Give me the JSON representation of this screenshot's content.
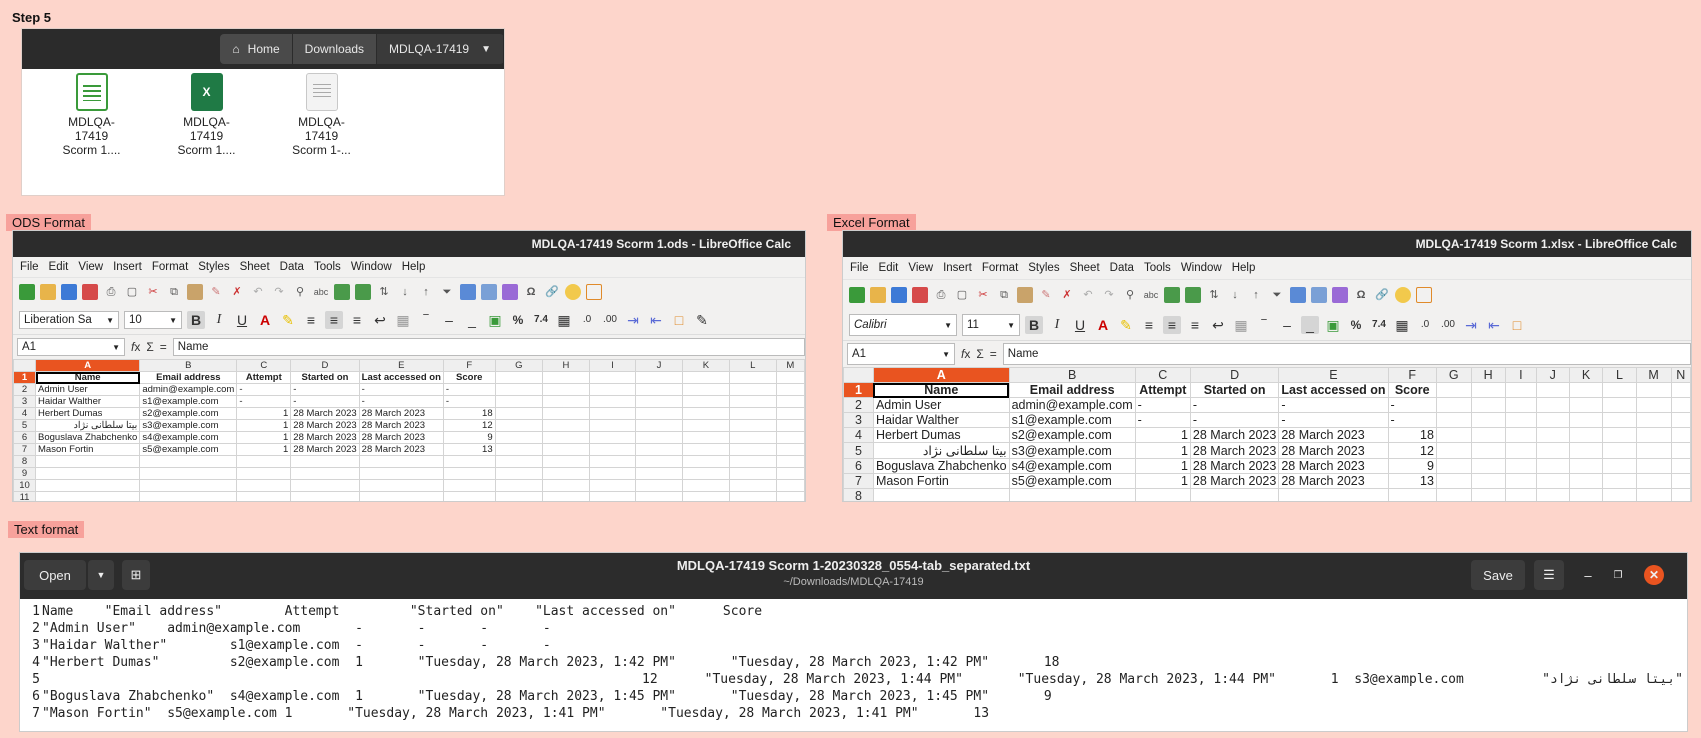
{
  "step_label": "Step 5",
  "file_manager": {
    "crumbs": [
      "Home",
      "Downloads",
      "MDLQA-17419"
    ],
    "files": [
      {
        "label": "MDLQA-17419 Scorm 1....",
        "icon": "spreadsheet-ods-icon"
      },
      {
        "label": "MDLQA-17419 Scorm 1....",
        "icon": "excel-xlsx-icon"
      },
      {
        "label": "MDLQA-17419 Scorm 1-...",
        "icon": "text-file-icon"
      }
    ],
    "xls_glyph": "X"
  },
  "ods": {
    "section_label": "ODS Format",
    "title": "MDLQA-17419 Scorm 1.ods - LibreOffice Calc",
    "menu": [
      "File",
      "Edit",
      "View",
      "Insert",
      "Format",
      "Styles",
      "Sheet",
      "Data",
      "Tools",
      "Window",
      "Help"
    ],
    "font_name": "Liberation Sa",
    "font_size": "10",
    "cell_ref": "A1",
    "formula": "Name",
    "columns": [
      "A",
      "B",
      "C",
      "D",
      "E",
      "F",
      "G",
      "H",
      "I",
      "J",
      "K",
      "L",
      "M"
    ],
    "rows": [
      [
        "Name",
        "Email address",
        "Attempt",
        "Started on",
        "Last accessed on",
        "Score"
      ],
      [
        "Admin User",
        "admin@example.com",
        "-",
        "-",
        "-",
        "-"
      ],
      [
        "Haidar Walther",
        "s1@example.com",
        "-",
        "-",
        "-",
        "-"
      ],
      [
        "Herbert Dumas",
        "s2@example.com",
        "1",
        "28 March 2023",
        "28 March 2023",
        "18"
      ],
      [
        "بیتا سلطانی نژاد",
        "s3@example.com",
        "1",
        "28 March 2023",
        "28 March 2023",
        "12"
      ],
      [
        "Boguslava Zhabchenko",
        "s4@example.com",
        "1",
        "28 March 2023",
        "28 March 2023",
        "9"
      ],
      [
        "Mason Fortin",
        "s5@example.com",
        "1",
        "28 March 2023",
        "28 March 2023",
        "13"
      ],
      [
        "",
        "",
        "",
        "",
        "",
        ""
      ],
      [
        "",
        "",
        "",
        "",
        "",
        ""
      ],
      [
        "",
        "",
        "",
        "",
        "",
        ""
      ],
      [
        "",
        "",
        "",
        "",
        "",
        ""
      ]
    ]
  },
  "xlsx": {
    "section_label": "Excel Format",
    "title": "MDLQA-17419 Scorm 1.xlsx - LibreOffice Calc",
    "menu": [
      "File",
      "Edit",
      "View",
      "Insert",
      "Format",
      "Styles",
      "Sheet",
      "Data",
      "Tools",
      "Window",
      "Help"
    ],
    "font_name": "Calibri",
    "font_size": "11",
    "cell_ref": "A1",
    "formula": "Name",
    "columns": [
      "A",
      "B",
      "C",
      "D",
      "E",
      "F",
      "G",
      "H",
      "I",
      "J",
      "K",
      "L",
      "M",
      "N"
    ],
    "rows": [
      [
        "Name",
        "Email address",
        "Attempt",
        "Started on",
        "Last accessed on",
        "Score"
      ],
      [
        "Admin User",
        "admin@example.com",
        "-",
        "-",
        "-",
        "-"
      ],
      [
        "Haidar Walther",
        "s1@example.com",
        "-",
        "-",
        "-",
        "-"
      ],
      [
        "Herbert Dumas",
        "s2@example.com",
        "1",
        "28 March 2023",
        "28 March 2023",
        "18"
      ],
      [
        "بیتا سلطانی نژاد",
        "s3@example.com",
        "1",
        "28 March 2023",
        "28 March 2023",
        "12"
      ],
      [
        "Boguslava Zhabchenko",
        "s4@example.com",
        "1",
        "28 March 2023",
        "28 March 2023",
        "9"
      ],
      [
        "Mason Fortin",
        "s5@example.com",
        "1",
        "28 March 2023",
        "28 March 2023",
        "13"
      ],
      [
        "",
        "",
        "",
        "",
        "",
        ""
      ]
    ]
  },
  "text": {
    "section_label": "Text format",
    "open_label": "Open",
    "save_label": "Save",
    "title": "MDLQA-17419 Scorm 1-20230328_0554-tab_separated.txt",
    "path": "~/Downloads/MDLQA-17419",
    "lines": [
      "Name    \"Email address\"        Attempt         \"Started on\"    \"Last accessed on\"      Score",
      "\"Admin User\"    admin@example.com       -       -       -       -",
      "\"Haidar Walther\"        s1@example.com  -       -       -       -",
      "\"Herbert Dumas\"         s2@example.com  1       \"Tuesday, 28 March 2023, 1:42 PM\"       \"Tuesday, 28 March 2023, 1:42 PM\"       18",
      "12      \"Tuesday, 28 March 2023, 1:44 PM\"       \"Tuesday, 28 March 2023, 1:44 PM\"       1  s3@example.com          \"بیتا سلطانی نژاد\"",
      "\"Boguslava Zhabchenko\"  s4@example.com  1       \"Tuesday, 28 March 2023, 1:45 PM\"       \"Tuesday, 28 March 2023, 1:45 PM\"       9",
      "\"Mason Fortin\"  s5@example.com 1       \"Tuesday, 28 March 2023, 1:41 PM\"       \"Tuesday, 28 March 2023, 1:41 PM\"       13"
    ]
  },
  "colors": {
    "accent": "#e95420",
    "background": "#fdd5cb",
    "titlebar": "#2c2c2c"
  }
}
